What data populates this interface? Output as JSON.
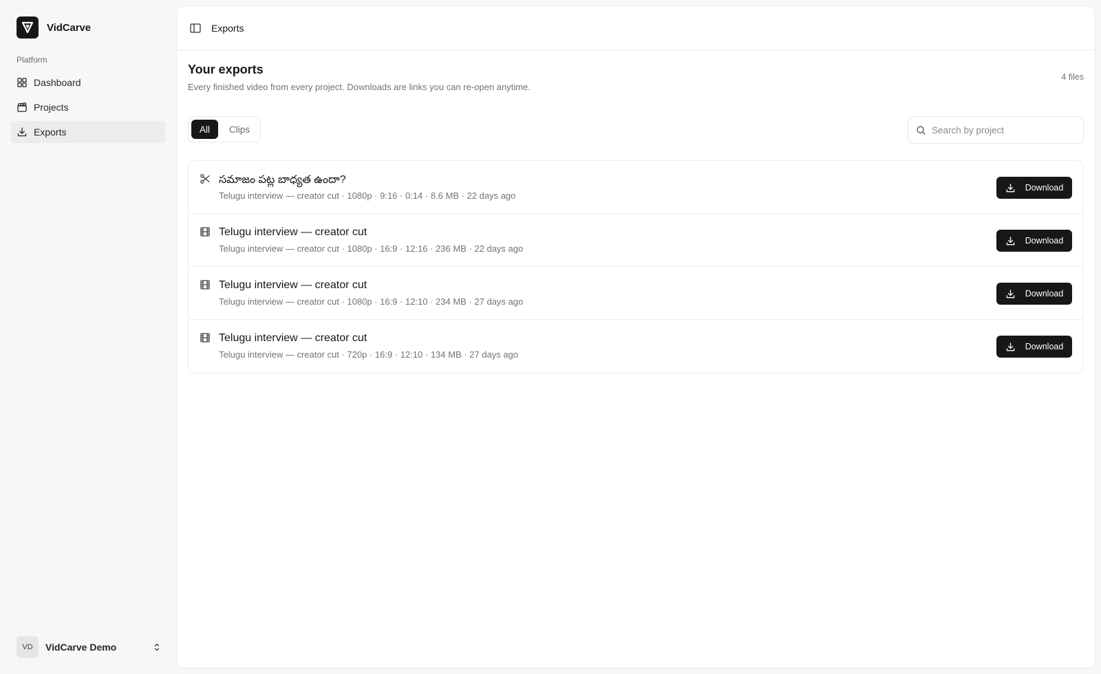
{
  "app": {
    "name": "VidCarve"
  },
  "sidebar": {
    "section_label": "Platform",
    "items": [
      {
        "label": "Dashboard",
        "icon": "dashboard-grid-icon",
        "active": false
      },
      {
        "label": "Projects",
        "icon": "clapperboard-icon",
        "active": false
      },
      {
        "label": "Exports",
        "icon": "download-icon",
        "active": true
      }
    ],
    "user": {
      "initials": "VD",
      "name": "VidCarve Demo"
    }
  },
  "header": {
    "title": "Exports",
    "toggle_icon": "sidebar-toggle-icon"
  },
  "page": {
    "title": "Your exports",
    "subtitle": "Every finished video from every project. Downloads are links you can re-open anytime.",
    "file_count": "4 files"
  },
  "filters": {
    "tabs": [
      {
        "label": "All",
        "active": true
      },
      {
        "label": "Clips",
        "active": false
      }
    ],
    "search_placeholder": "Search by project"
  },
  "exports": [
    {
      "icon": "scissors-icon",
      "title": "సమాజం పట్ల బాధ్యత ఉందా?",
      "meta": "Telugu interview — creator cut · 1080p · 9:16 · 0:14 · 8.6 MB · 22 days ago",
      "button": "Download"
    },
    {
      "icon": "film-icon",
      "title": "Telugu interview — creator cut",
      "meta": "Telugu interview — creator cut · 1080p · 16:9 · 12:16 · 236 MB · 22 days ago",
      "button": "Download"
    },
    {
      "icon": "film-icon",
      "title": "Telugu interview — creator cut",
      "meta": "Telugu interview — creator cut · 1080p · 16:9 · 12:10 · 234 MB · 27 days ago",
      "button": "Download"
    },
    {
      "icon": "film-icon",
      "title": "Telugu interview — creator cut",
      "meta": "Telugu interview — creator cut · 720p · 16:9 · 12:10 · 134 MB · 27 days ago",
      "button": "Download"
    }
  ],
  "colors": {
    "accent": "#171717",
    "muted_text": "#737373",
    "active_nav_bg": "#ececec"
  }
}
